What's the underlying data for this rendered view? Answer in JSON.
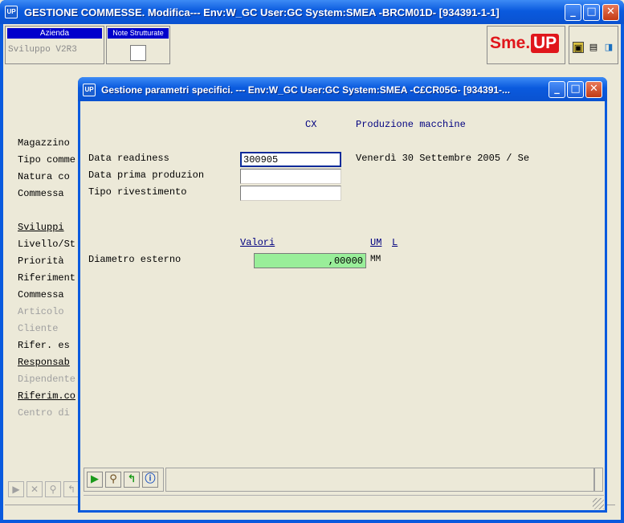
{
  "outer_window": {
    "icon": "UP",
    "title": "GESTIONE COMMESSE.  Modifica--- Env:W_GC User:GC System:SMEA -BRCM01D- [934391-1-1]",
    "azienda_header": "Azienda",
    "azienda_value": "Sviluppo V2R3",
    "note_header": "Note Strutturate",
    "logo_left": "Sme.",
    "logo_right": "UP",
    "labels": [
      {
        "text": "Magazzino",
        "style": "normal"
      },
      {
        "text": "Tipo comme",
        "style": "normal"
      },
      {
        "text": "Natura co",
        "style": "normal"
      },
      {
        "text": "Commessa",
        "style": "normal"
      },
      {
        "text": "Sviluppi",
        "style": "underline"
      },
      {
        "text": "Livello/St",
        "style": "normal"
      },
      {
        "text": "Priorità",
        "style": "normal"
      },
      {
        "text": "Riferiment",
        "style": "normal"
      },
      {
        "text": "Commessa",
        "style": "normal"
      },
      {
        "text": "Articolo",
        "style": "gray"
      },
      {
        "text": "Cliente",
        "style": "gray"
      },
      {
        "text": "Rifer. es",
        "style": "normal"
      },
      {
        "text": "Responsab",
        "style": "underline"
      },
      {
        "text": "Dipendente",
        "style": "gray"
      },
      {
        "text": "Riferim.co",
        "style": "underline"
      },
      {
        "text": "Centro di",
        "style": "gray"
      }
    ]
  },
  "dialog": {
    "icon": "UP",
    "title": "Gestione parametri specifici. --- Env:W_GC User:GC System:SMEA -C£CR05G- [934391-...",
    "code": "CX",
    "code_description": "Produzione macchine",
    "fields": {
      "data_readiness_label": "Data readiness",
      "data_readiness_value": "300905",
      "data_readiness_decoded": "Venerdì 30 Settembre 2005 / Se",
      "data_prima_label": "Data prima produzion",
      "data_prima_value": "",
      "tipo_rivestimento_label": "Tipo rivestimento",
      "tipo_rivestimento_value": ""
    },
    "values_section": {
      "valori_header": "Valori",
      "um_header": "UM",
      "l_header": "L",
      "diametro_label": "Diametro esterno",
      "diametro_value": ",00000",
      "diametro_um": "MM"
    }
  },
  "window_buttons": {
    "minimize": "_",
    "maximize": "□",
    "close": "✕"
  },
  "colors": {
    "titlebar": "#0a5ade",
    "field_green": "#99ee99",
    "azienda_header": "#0000cc",
    "logo_red": "#e0161b"
  }
}
